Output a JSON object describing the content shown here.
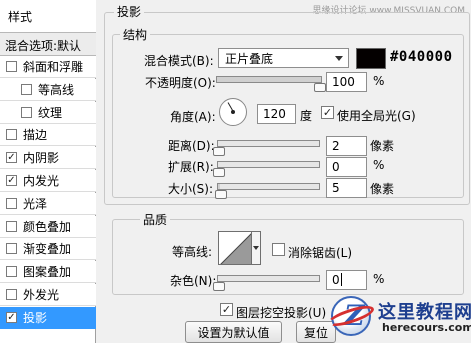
{
  "watermark_top": "思缘设计论坛 www.MISSVUAN.COM",
  "styles_panel": {
    "title": "样式",
    "blending_options": "混合选项:默认",
    "items": [
      {
        "label": "斜面和浮雕",
        "checked": false,
        "sub": false,
        "selected": false
      },
      {
        "label": "等高线",
        "checked": false,
        "sub": true,
        "selected": false
      },
      {
        "label": "纹理",
        "checked": false,
        "sub": true,
        "selected": false
      },
      {
        "label": "描边",
        "checked": false,
        "sub": false,
        "selected": false
      },
      {
        "label": "内阴影",
        "checked": true,
        "sub": false,
        "selected": false
      },
      {
        "label": "内发光",
        "checked": true,
        "sub": false,
        "selected": false
      },
      {
        "label": "光泽",
        "checked": false,
        "sub": false,
        "selected": false
      },
      {
        "label": "颜色叠加",
        "checked": false,
        "sub": false,
        "selected": false
      },
      {
        "label": "渐变叠加",
        "checked": false,
        "sub": false,
        "selected": false
      },
      {
        "label": "图案叠加",
        "checked": false,
        "sub": false,
        "selected": false
      },
      {
        "label": "外发光",
        "checked": false,
        "sub": false,
        "selected": false
      },
      {
        "label": "投影",
        "checked": true,
        "sub": false,
        "selected": true
      }
    ]
  },
  "drop_shadow": {
    "title": "投影",
    "structure": {
      "title": "结构",
      "blend_mode_label": "混合模式(B):",
      "blend_mode_value": "正片叠底",
      "color_hex": "#040000",
      "color": "#040000",
      "opacity_label": "不透明度(O):",
      "opacity_value": "100",
      "opacity_fraction": 1.0,
      "percent": "%",
      "angle_label": "角度(A):",
      "angle_value": "120",
      "angle_unit": "度",
      "global_light_label": "使用全局光(G)",
      "global_light_checked": true,
      "distance_label": "距离(D):",
      "distance_value": "2",
      "distance_unit": "像素",
      "spread_label": "扩展(R):",
      "spread_value": "0",
      "size_label": "大小(S):",
      "size_value": "5",
      "size_unit": "像素"
    },
    "quality": {
      "title": "品质",
      "contour_label": "等高线:",
      "anti_aliased_label": "消除锯齿(L)",
      "anti_aliased_checked": false,
      "noise_label": "杂色(N):",
      "noise_value": "0",
      "percent": "%"
    },
    "knockout_label": "图层挖空投影(U)",
    "knockout_checked": true,
    "make_default_button": "设置为默认值",
    "reset_default_button": "复位"
  },
  "site_watermark": {
    "title": "这里教程网",
    "url": "herecours.com"
  }
}
